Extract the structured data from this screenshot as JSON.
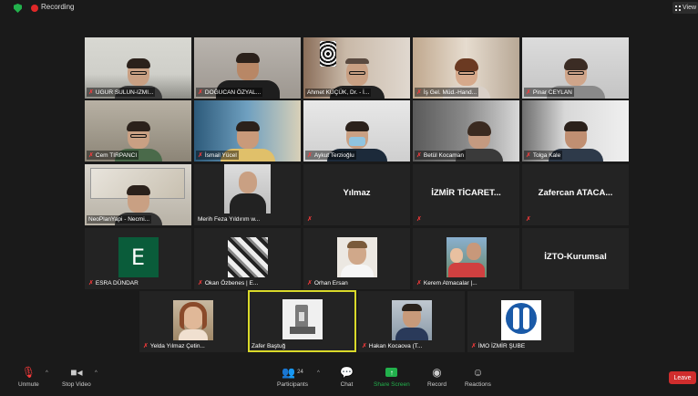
{
  "window": {
    "recording_label": "Recording",
    "view_label": "View"
  },
  "colors": {
    "recording": "#e02828",
    "share": "#22b14c",
    "leave": "#d02d2d",
    "highlight": "#d9d92a",
    "muted": "#ff3b3b"
  },
  "tiles": {
    "r1": [
      "UGUR SULUN-IZMI...",
      "DOĞUCAN ÖZYAL...",
      "Ahmet KÜÇÜK, Dr. - İ...",
      "İş Gel. Müd.-Hand...",
      "Pinar CEYLAN"
    ],
    "r2": [
      "Cem TIRPANCI",
      "İsmail Yücel",
      "Aykut Terzioğlu",
      "Betül Kocaman",
      "Tolga Kale"
    ],
    "r3": [
      "NeoPlanYapi - Necmi...",
      "Merih Feza Yıldırım w...",
      "Yılmaz",
      "İZMİR TİCARET...",
      "Zafercan ATACA..."
    ],
    "r4": [
      "ESRA DÜNDAR",
      "Okan Özbenes | E...",
      "Orhan Ersan",
      "Kerem Atmacalar |...",
      "İZTO-Kurumsal"
    ],
    "r5": [
      "Yelda Yılmaz Çetin...",
      "Zafer Baştuğ",
      "Hakan Kocaova (T...",
      "İMO İZMİR ŞUBE"
    ],
    "esra_letter": "E"
  },
  "toolbar": {
    "unmute": "Unmute",
    "stop_video": "Stop Video",
    "participants": "Participants",
    "participants_count": "24",
    "chat": "Chat",
    "share": "Share Screen",
    "record": "Record",
    "reactions": "Reactions",
    "leave": "Leave"
  }
}
